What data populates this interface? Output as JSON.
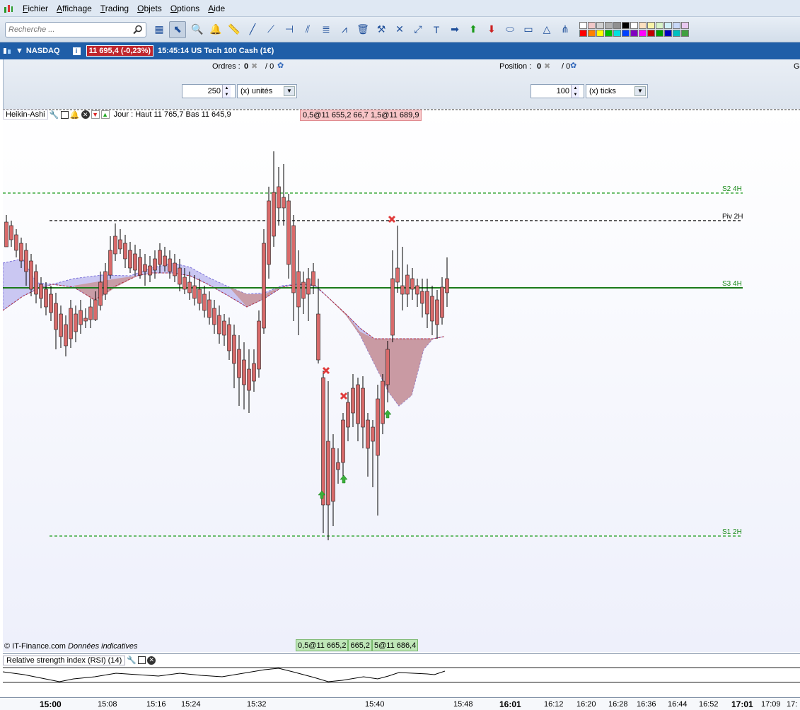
{
  "menu": {
    "items": [
      "Fichier",
      "Affichage",
      "Trading",
      "Objets",
      "Options",
      "Aide"
    ]
  },
  "toolbar": {
    "search_placeholder": "Recherche ...",
    "tools": [
      "screener-icon",
      "cursor-icon",
      "zoom-icon",
      "alert-bell-icon",
      "ruler-icon",
      "segment-icon",
      "line-icon",
      "horizontal-line-icon",
      "parallel-lines-icon",
      "fibonacci-icon",
      "channel-icon",
      "trash-icon",
      "hammer-icon",
      "cross-icon",
      "diagonal-icon",
      "text-icon",
      "arrow-right-icon",
      "arrow-up-icon",
      "arrow-down-icon",
      "ellipse-icon",
      "rectangle-icon",
      "triangle-icon",
      "pitchfork-icon"
    ],
    "swatches": [
      "#ffffff",
      "#f0c8c8",
      "#d0d0d0",
      "#b0b0b0",
      "#909090",
      "#000000",
      "#ffffff",
      "#fce0c0",
      "#f8f4a8",
      "#d8f4c8",
      "#d0f0f8",
      "#c8d8f8",
      "#e8c8f0",
      "#ff0000",
      "#ff8000",
      "#ffff00",
      "#00c000",
      "#00e0e0",
      "#0040ff",
      "#8000c0",
      "#ff00ff",
      "#c00000",
      "#00a000",
      "#0000c0",
      "#00c0c0",
      "#40a040"
    ]
  },
  "instrument": {
    "name": "NASDAQ",
    "price_badge": "11 695,4 (-0,23%)",
    "time_desc": "15:45:14 US Tech 100 Cash (1€)"
  },
  "orders": {
    "ordres_label": "Ordres :",
    "ordres_value": "0",
    "ordres_sep": "/ 0",
    "position_label": "Position :",
    "position_value": "0",
    "position_sep": "/ 0",
    "right_letter": "G",
    "qty1": "250",
    "unit1": "(x) unités",
    "qty2": "100",
    "unit2": "(x) ticks"
  },
  "chart": {
    "title": "Heikin-Ashi",
    "info": "Jour : Haut 11 765,7  Bas 11 645,9",
    "top_badge": "0,5@11 655,2 66,7 1,5@11 689,9",
    "bottom_badge": [
      "0,5@11 665,2",
      "665,2",
      "5@11 686,4"
    ],
    "footnote_brand": "© IT-Finance.com",
    "footnote_note": "Données indicatives",
    "levels": [
      {
        "name": "S2 4H",
        "price": 11752,
        "color": "#1a9a1a",
        "style": "dashed"
      },
      {
        "name": "Piv 2H",
        "price": 11744,
        "color": "#000000",
        "style": "dashed"
      },
      {
        "name": "S3 4H",
        "price": 11725,
        "color": "#1a7a1a",
        "style": "solid"
      },
      {
        "name": "S1 2H",
        "price": 11653,
        "color": "#1a9a1a",
        "style": "dashed"
      }
    ],
    "colors": {
      "bull": "#5cc45c",
      "bear": "#d86a6a",
      "cloud_upper": "#b9b6ee",
      "cloud_lower": "#c9959a"
    }
  },
  "rsi": {
    "title": "Relative strength index (RSI) (14)"
  },
  "time_axis": {
    "labels": [
      {
        "t": "15:00",
        "major": true
      },
      {
        "t": "15:08",
        "major": false
      },
      {
        "t": "15:16",
        "major": false
      },
      {
        "t": "15:24",
        "major": false
      },
      {
        "t": "15:32",
        "major": false
      },
      {
        "t": "15:40",
        "major": false
      },
      {
        "t": "15:48",
        "major": false
      },
      {
        "t": "16:01",
        "major": true
      },
      {
        "t": "16:12",
        "major": false
      },
      {
        "t": "16:20",
        "major": false
      },
      {
        "t": "16:28",
        "major": false
      },
      {
        "t": "16:36",
        "major": false
      },
      {
        "t": "16:44",
        "major": false
      },
      {
        "t": "16:52",
        "major": false
      },
      {
        "t": "17:01",
        "major": true
      },
      {
        "t": "17:09",
        "major": false
      },
      {
        "t": "17:",
        "major": false
      }
    ]
  }
}
